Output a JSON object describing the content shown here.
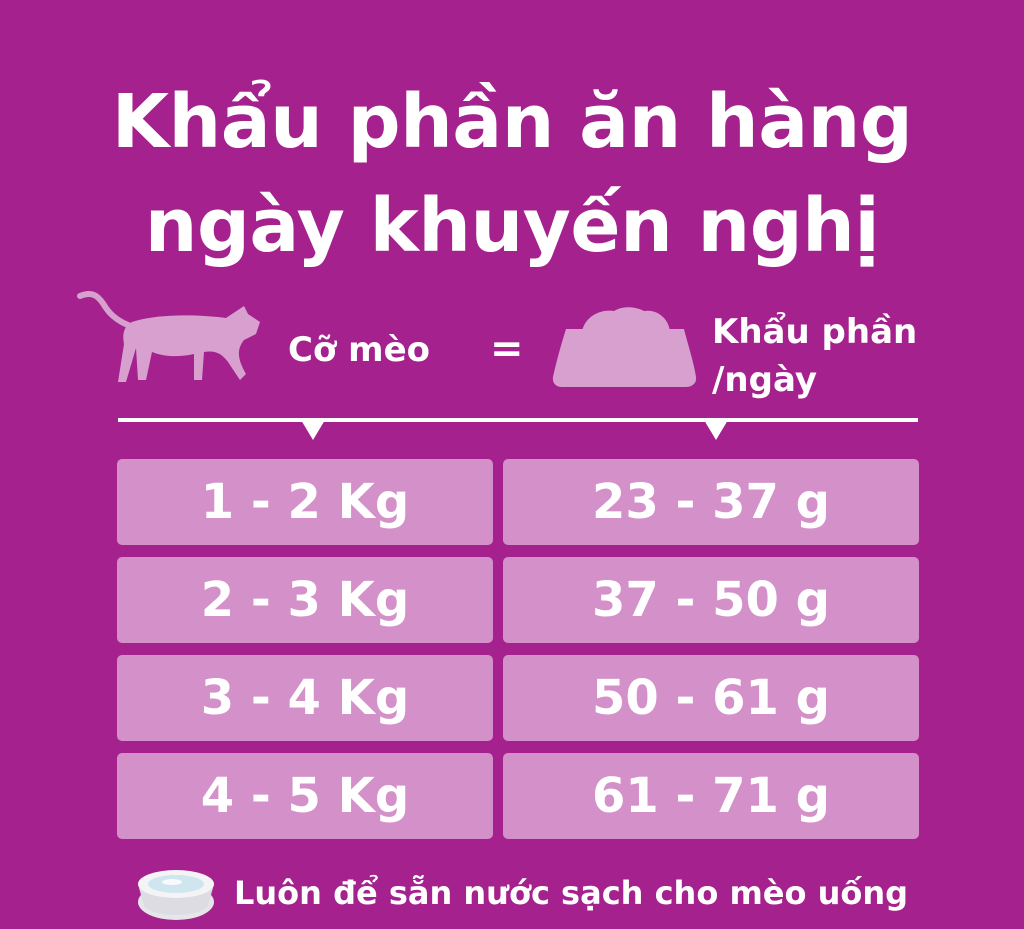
{
  "title": {
    "line1": "Khẩu phần ăn hàng",
    "line2": "ngày khuyến nghị"
  },
  "header": {
    "size_label": "Cỡ mèo",
    "equals": "=",
    "portion_label_line1": "Khẩu phần",
    "portion_label_line2": "/ngày",
    "cat_icon": "cat-icon",
    "bowl_icon": "food-bowl-icon"
  },
  "table": {
    "rows": [
      {
        "size": "1 - 2 Kg",
        "portion": "23 - 37 g"
      },
      {
        "size": "2 - 3 Kg",
        "portion": "37 - 50 g"
      },
      {
        "size": "3 - 4 Kg",
        "portion": "50 - 61 g"
      },
      {
        "size": "4 - 5 Kg",
        "portion": "61 - 71 g"
      }
    ]
  },
  "footer": {
    "text": "Luôn để sẵn nước sạch cho mèo uống",
    "icon": "water-bowl-icon"
  },
  "colors": {
    "background": "#a4218e",
    "cell": "#d490c9",
    "icon": "#d8a0cf",
    "text": "#ffffff"
  }
}
